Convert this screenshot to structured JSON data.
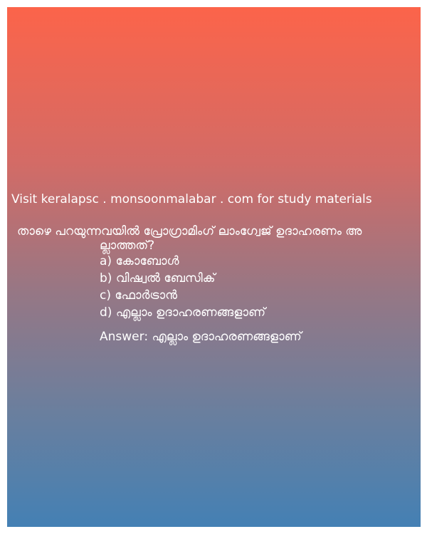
{
  "card": {
    "visit_text": "Visit keralapsc . monsoonmalabar . com for study materials",
    "question_line1": "താഴെ പറയുന്നവയിൽ പ്രോഗ്രാമിംഗ് ലാംഗ്വേജ് ഉദാഹരണം അ",
    "question_line2": "ല്ലാത്തത്?",
    "options": [
      "a) കോബോൾ",
      "b) വിഷ്വൽ ബേസിക്",
      "c) ഫോർട്രാൻ",
      "d) എല്ലാം ഉദാഹരണങ്ങളാണ്"
    ],
    "answer": "Answer: എല്ലാം ഉദാഹരണങ്ങളാണ്"
  },
  "colors": {
    "gradient_top": "#fc644a",
    "gradient_bottom": "#4480b4",
    "text": "#ffffff"
  }
}
